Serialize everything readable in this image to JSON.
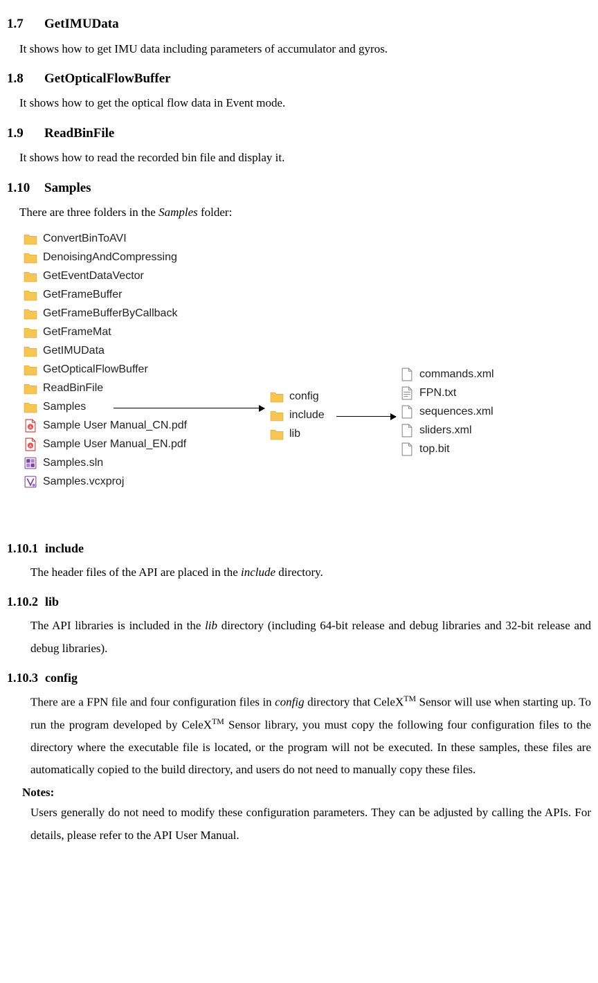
{
  "sections": {
    "s17": {
      "num": "1.7",
      "title": "GetIMUData",
      "body": "It shows how to get IMU data including parameters of accumulator and gyros."
    },
    "s18": {
      "num": "1.8",
      "title": "GetOpticalFlowBuffer",
      "body": "It shows how to get the optical flow data in Event mode."
    },
    "s19": {
      "num": "1.9",
      "title": "ReadBinFile",
      "body": "It shows how to read the recorded bin file and display it."
    },
    "s110": {
      "num": "1.10",
      "title": "Samples",
      "body_prefix": "There are three folders in the ",
      "body_em": "Samples",
      "body_suffix": " folder:"
    },
    "s1101": {
      "num": "1.10.1",
      "title": "include",
      "body_prefix": "The header files of the API are placed in the ",
      "body_em": "include",
      "body_suffix": " directory."
    },
    "s1102": {
      "num": "1.10.2",
      "title": "lib",
      "body_prefix": "The API libraries is included in the ",
      "body_em": "lib",
      "body_suffix": " directory (including 64-bit release and debug libraries and 32-bit release and debug libraries)."
    },
    "s1103": {
      "num": "1.10.3",
      "title": "config",
      "p1a": "There are a FPN file and four configuration files in ",
      "p1em": "config",
      "p1b": " directory that CeleX",
      "p1tm": "TM",
      "p1c": " Sensor will use when starting up. To run the program developed by CeleX",
      "p1tm2": "TM",
      "p1d": " Sensor library, you must copy the following four configuration files to the directory where the executable file is located, or the program will not be executed. In these samples, these files are automatically copied to the build directory, and users do not need to manually copy these files."
    },
    "notes": {
      "label": "Notes:",
      "body": "Users generally do not need to modify these configuration parameters. They can be adjusted by calling the APIs. For details, please refer to the API User Manual."
    }
  },
  "diagram": {
    "colA": [
      {
        "icon": "folder",
        "label": "ConvertBinToAVI"
      },
      {
        "icon": "folder",
        "label": "DenoisingAndCompressing"
      },
      {
        "icon": "folder",
        "label": "GetEventDataVector"
      },
      {
        "icon": "folder",
        "label": "GetFrameBuffer"
      },
      {
        "icon": "folder",
        "label": "GetFrameBufferByCallback"
      },
      {
        "icon": "folder",
        "label": "GetFrameMat"
      },
      {
        "icon": "folder",
        "label": "GetIMUData"
      },
      {
        "icon": "folder",
        "label": "GetOpticalFlowBuffer"
      },
      {
        "icon": "folder",
        "label": "ReadBinFile"
      },
      {
        "icon": "folder",
        "label": "Samples"
      },
      {
        "icon": "pdf",
        "label": "Sample User Manual_CN.pdf"
      },
      {
        "icon": "pdf",
        "label": "Sample User Manual_EN.pdf"
      },
      {
        "icon": "sln",
        "label": "Samples.sln"
      },
      {
        "icon": "vcxproj",
        "label": "Samples.vcxproj"
      }
    ],
    "colB": [
      {
        "icon": "folder",
        "label": "config"
      },
      {
        "icon": "folder",
        "label": "include"
      },
      {
        "icon": "folder",
        "label": "lib"
      }
    ],
    "colC": [
      {
        "icon": "file",
        "label": "commands.xml"
      },
      {
        "icon": "txt",
        "label": "FPN.txt"
      },
      {
        "icon": "file",
        "label": "sequences.xml"
      },
      {
        "icon": "file",
        "label": "sliders.xml"
      },
      {
        "icon": "file",
        "label": "top.bit"
      }
    ]
  }
}
